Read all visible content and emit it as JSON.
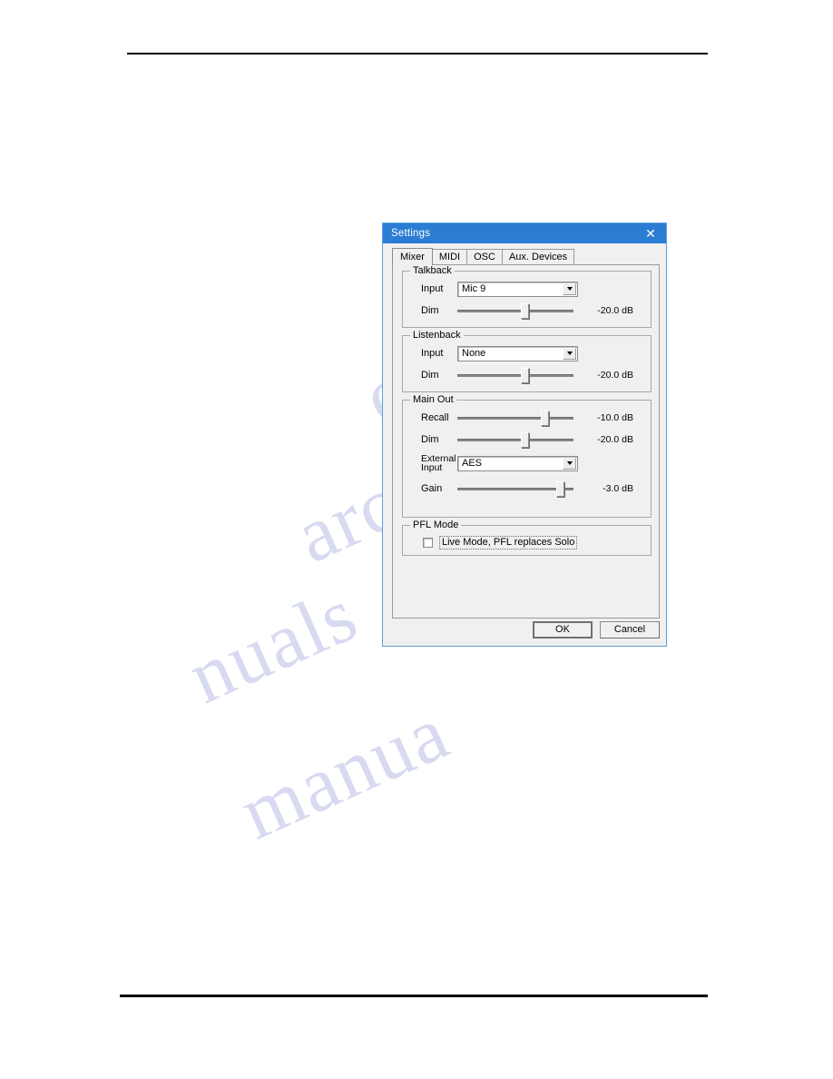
{
  "page": {
    "header_rule": "horizontal-rule",
    "footer_rule": "horizontal-rule",
    "watermark_lines": [
      "com",
      "archive",
      "nuals",
      "manua"
    ]
  },
  "dialog": {
    "title": "Settings",
    "close_icon": "close-icon",
    "tabs": [
      {
        "label": "Mixer",
        "selected": true
      },
      {
        "label": "MIDI",
        "selected": false
      },
      {
        "label": "OSC",
        "selected": false
      },
      {
        "label": "Aux. Devices",
        "selected": false
      }
    ],
    "groups": {
      "talkback": {
        "legend": "Talkback",
        "input_label": "Input",
        "input_value": "Mic 9",
        "dim_label": "Dim",
        "dim_value": "-20.0 dB",
        "dim_percent": 59
      },
      "listenback": {
        "legend": "Listenback",
        "input_label": "Input",
        "input_value": "None",
        "dim_label": "Dim",
        "dim_value": "-20.0 dB",
        "dim_percent": 59
      },
      "main_out": {
        "legend": "Main Out",
        "recall_label": "Recall",
        "recall_value": "-10.0 dB",
        "recall_percent": 77,
        "dim_label": "Dim",
        "dim_value": "-20.0 dB",
        "dim_percent": 59,
        "external_input_label": "External Input",
        "external_input_label_line1": "External",
        "external_input_label_line2": "Input",
        "external_input_value": "AES",
        "gain_label": "Gain",
        "gain_value": "-3.0 dB",
        "gain_percent": 92
      },
      "pfl_mode": {
        "legend": "PFL Mode",
        "checkbox_label": "Live Mode,  PFL replaces Solo",
        "checkbox_checked": false
      }
    },
    "buttons": {
      "ok": "OK",
      "cancel": "Cancel"
    }
  },
  "colors": {
    "titlebar": "#2b7cd3",
    "dialog_face": "#f0f0f0",
    "dialog_border": "#5aa0e0",
    "watermark": "#b9bde6"
  }
}
